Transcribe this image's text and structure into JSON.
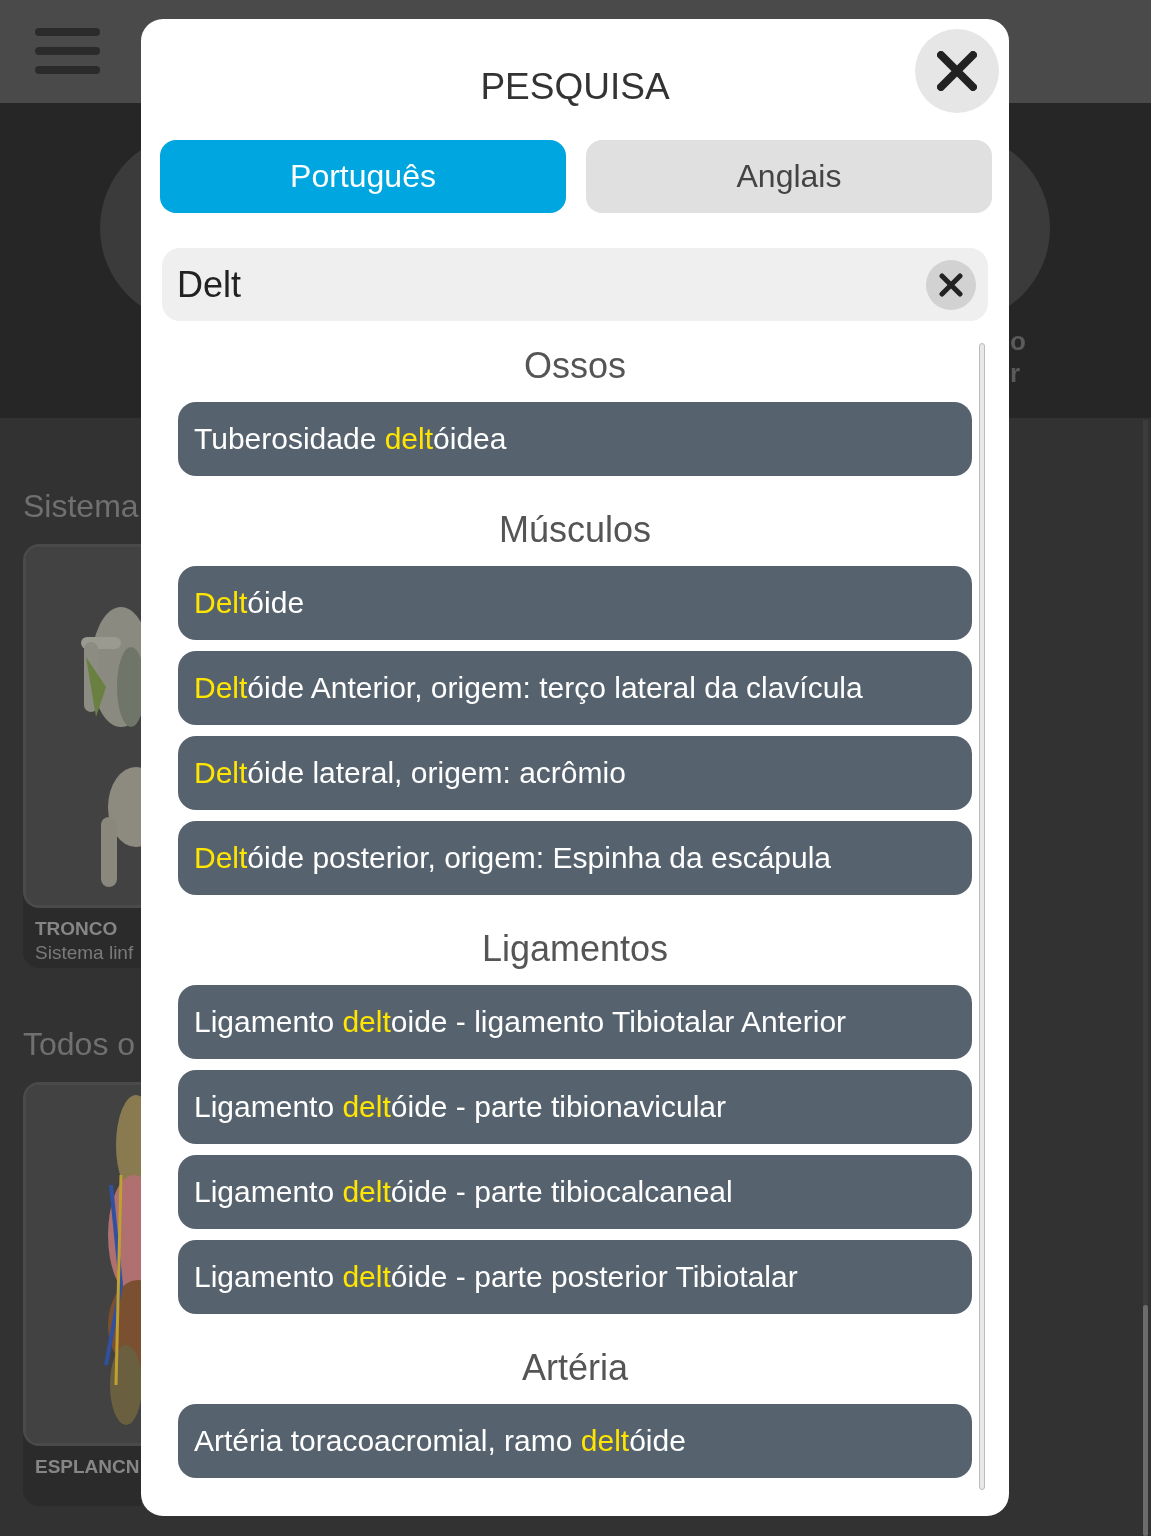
{
  "background": {
    "top_right_label": [
      "o",
      "r"
    ],
    "sections": [
      {
        "heading": "Sistema",
        "card": {
          "title": "TRONCO",
          "subtitle": "Sistema linf"
        }
      },
      {
        "heading": "Todos o",
        "card": {
          "title": "ESPLANCN"
        }
      }
    ]
  },
  "dialog": {
    "title": "PESQUISA",
    "tabs": [
      {
        "label": "Português",
        "selected": true
      },
      {
        "label": "Anglais",
        "selected": false
      }
    ],
    "search": {
      "value": "Delt"
    },
    "sections": [
      {
        "heading": "Ossos",
        "items": [
          {
            "parts": [
              {
                "text": "Tuberosidade ",
                "match": false
              },
              {
                "text": "delt",
                "match": true
              },
              {
                "text": "óidea",
                "match": false
              }
            ]
          }
        ]
      },
      {
        "heading": "Músculos",
        "items": [
          {
            "parts": [
              {
                "text": "Delt",
                "match": true
              },
              {
                "text": "óide",
                "match": false
              }
            ]
          },
          {
            "parts": [
              {
                "text": "Delt",
                "match": true
              },
              {
                "text": "óide Anterior, origem: terço lateral da clavícula",
                "match": false
              }
            ]
          },
          {
            "parts": [
              {
                "text": "Delt",
                "match": true
              },
              {
                "text": "óide lateral, origem: acrômio",
                "match": false
              }
            ]
          },
          {
            "parts": [
              {
                "text": "Delt",
                "match": true
              },
              {
                "text": "óide posterior, origem: Espinha da escápula",
                "match": false
              }
            ]
          }
        ]
      },
      {
        "heading": "Ligamentos",
        "items": [
          {
            "parts": [
              {
                "text": "Ligamento ",
                "match": false
              },
              {
                "text": "delt",
                "match": true
              },
              {
                "text": "oide - ligamento Tibiotalar Anterior",
                "match": false
              }
            ]
          },
          {
            "parts": [
              {
                "text": "Ligamento ",
                "match": false
              },
              {
                "text": "delt",
                "match": true
              },
              {
                "text": "óide - parte tibionavicular",
                "match": false
              }
            ]
          },
          {
            "parts": [
              {
                "text": "Ligamento ",
                "match": false
              },
              {
                "text": "delt",
                "match": true
              },
              {
                "text": "óide - parte tibiocalcaneal",
                "match": false
              }
            ]
          },
          {
            "parts": [
              {
                "text": "Ligamento ",
                "match": false
              },
              {
                "text": "delt",
                "match": true
              },
              {
                "text": "óide - parte posterior Tibiotalar",
                "match": false
              }
            ]
          }
        ]
      },
      {
        "heading": "Artéria",
        "items": [
          {
            "parts": [
              {
                "text": "Artéria toracoacromial, ramo ",
                "match": false
              },
              {
                "text": "delt",
                "match": true
              },
              {
                "text": "óide",
                "match": false
              }
            ]
          }
        ]
      }
    ]
  }
}
